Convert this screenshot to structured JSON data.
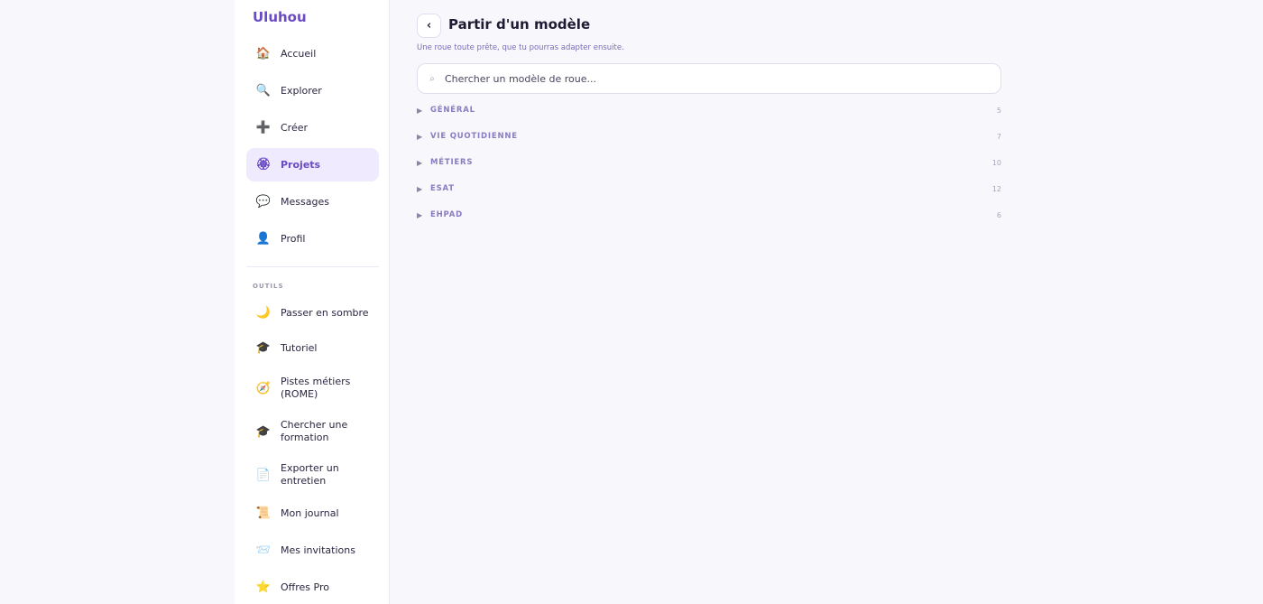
{
  "app": {
    "brand": "Uluhou"
  },
  "sidebar": {
    "items": [
      {
        "label": "Accueil",
        "icon": "🏠",
        "icon_name": "house-icon"
      },
      {
        "label": "Explorer",
        "icon": "🔍",
        "icon_name": "magnifier-icon"
      },
      {
        "label": "Créer",
        "icon": "➕",
        "icon_name": "plus-icon"
      },
      {
        "label": "Projets",
        "icon": "🏵",
        "icon_name": "rosette-icon",
        "active": true
      },
      {
        "label": "Messages",
        "icon": "💬",
        "icon_name": "speech-bubble-icon"
      },
      {
        "label": "Profil",
        "icon": "👤",
        "icon_name": "person-icon"
      }
    ],
    "tools_label": "OUTILS",
    "tools": [
      {
        "label": "Passer en sombre",
        "icon": "🌙",
        "icon_name": "moon-icon"
      },
      {
        "label": "Tutoriel",
        "icon": "🎓",
        "icon_name": "graduation-cap-icon"
      },
      {
        "label": "Pistes métiers (ROME)",
        "icon": "🧭",
        "icon_name": "compass-icon"
      },
      {
        "label": "Chercher une formation",
        "icon": "🎓",
        "icon_name": "graduation-cap-icon"
      },
      {
        "label": "Exporter un entretien",
        "icon": "📄",
        "icon_name": "document-icon"
      },
      {
        "label": "Mon journal",
        "icon": "📜",
        "icon_name": "scroll-icon"
      },
      {
        "label": "Mes invitations",
        "icon": "📨",
        "icon_name": "envelope-icon"
      },
      {
        "label": "Offres Pro",
        "icon": "⭐",
        "icon_name": "star-icon"
      }
    ]
  },
  "main": {
    "back_icon": "‹",
    "title": "Partir d'un modèle",
    "subtitle": "Une roue toute prête, que tu pourras adapter ensuite.",
    "search": {
      "placeholder": "Chercher un modèle de roue...",
      "value": "",
      "icon": "⌕"
    },
    "expand_icon": "▶",
    "categories": [
      {
        "name": "GÉNÉRAL",
        "count": "5"
      },
      {
        "name": "VIE QUOTIDIENNE",
        "count": "7"
      },
      {
        "name": "MÉTIERS",
        "count": "10"
      },
      {
        "name": "ESAT",
        "count": "12"
      },
      {
        "name": "EHPAD",
        "count": "6"
      }
    ]
  },
  "colors": {
    "accent": "#6a4bc4",
    "active_bg": "#efeafd",
    "page_bg": "#f8f7fc",
    "category_text": "#8a7cc0"
  }
}
